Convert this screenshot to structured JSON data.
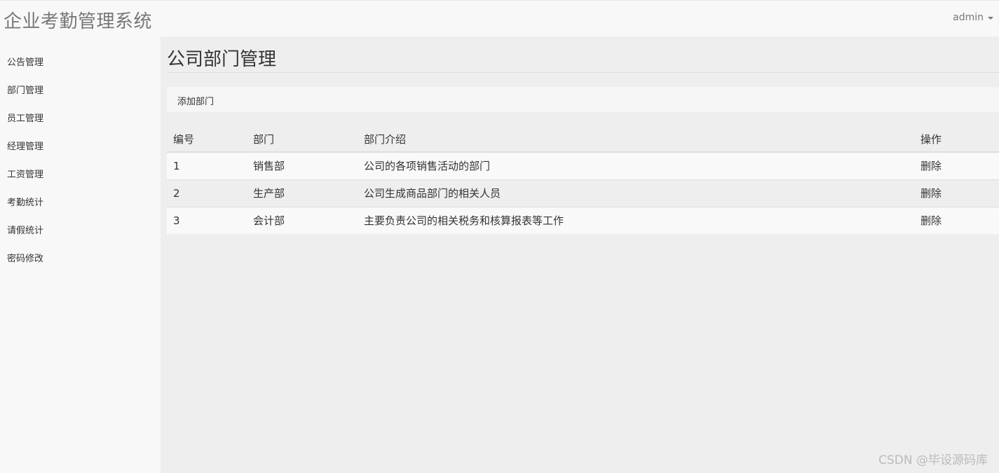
{
  "header": {
    "title": "企业考勤管理系统",
    "user": "admin"
  },
  "sidebar": {
    "items": [
      {
        "label": "公告管理"
      },
      {
        "label": "部门管理"
      },
      {
        "label": "员工管理"
      },
      {
        "label": "经理管理"
      },
      {
        "label": "工资管理"
      },
      {
        "label": "考勤统计"
      },
      {
        "label": "请假统计"
      },
      {
        "label": "密码修改"
      }
    ]
  },
  "main": {
    "title": "公司部门管理",
    "add_label": "添加部门",
    "columns": [
      "编号",
      "部门",
      "部门介绍",
      "操作"
    ],
    "rows": [
      {
        "id": "1",
        "dept": "销售部",
        "desc": "公司的各项销售活动的部门",
        "action": "删除"
      },
      {
        "id": "2",
        "dept": "生产部",
        "desc": "公司生成商品部门的相关人员",
        "action": "删除"
      },
      {
        "id": "3",
        "dept": "会计部",
        "desc": "主要负责公司的相关税务和核算报表等工作",
        "action": "删除"
      }
    ]
  },
  "watermark": "CSDN @毕设源码库"
}
